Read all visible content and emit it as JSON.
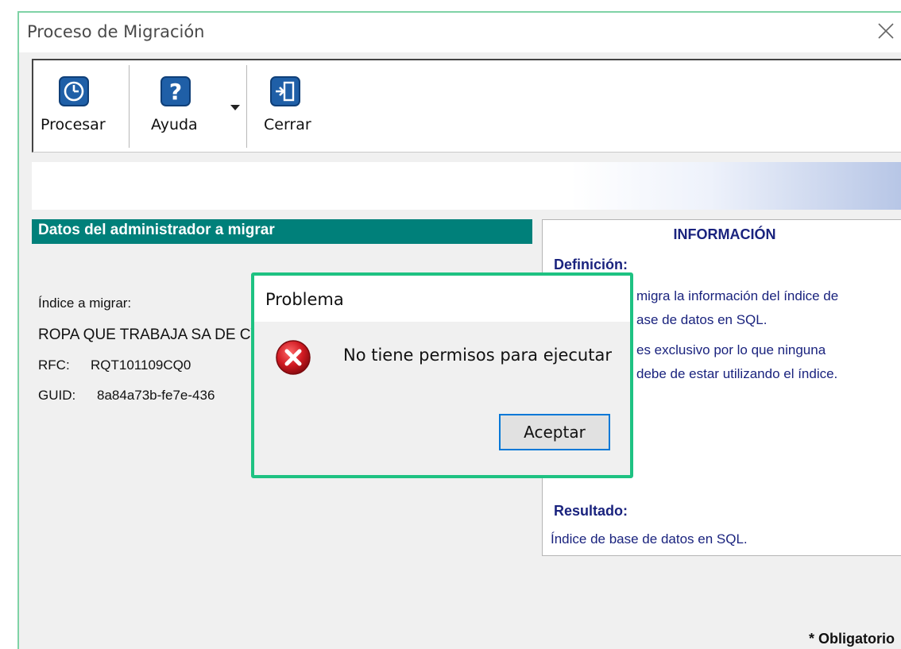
{
  "window": {
    "title": "Proceso de Migración"
  },
  "toolbar": {
    "procesar_label": "Procesar",
    "ayuda_label": "Ayuda",
    "cerrar_label": "Cerrar"
  },
  "section": {
    "header": "Datos del administrador a migrar"
  },
  "admin": {
    "indice_label": "Índice a migrar:",
    "company": "ROPA QUE TRABAJA SA DE CV",
    "rfc_label": "RFC:",
    "rfc_value": "RQT101109CQ0",
    "guid_label": "GUID:",
    "guid_value": "8a84a73b-fe7e-436"
  },
  "info": {
    "title": "INFORMACIÓN",
    "definicion_heading": "Definición:",
    "def_line1": "migra la información del índice de",
    "def_line2": "ase de datos en SQL.",
    "def_line3": "es exclusivo por lo que ninguna",
    "def_line4": "debe de estar utilizando el índice.",
    "resultado_heading": "Resultado:",
    "resultado_text": "Índice de base de datos en SQL."
  },
  "footer": {
    "obligatorio": "* Obligatorio"
  },
  "dialog": {
    "title": "Problema",
    "message": "No tiene permisos para ejecutar",
    "ok_label": "Aceptar"
  },
  "colors": {
    "section_header": "#00807a",
    "info_text": "#1a237e",
    "dialog_highlight": "#1ec282",
    "icon_blue": "#1f5fa7",
    "error_red": "#c8141e"
  },
  "icons": {
    "procesar": "clock-icon",
    "ayuda": "question-icon",
    "cerrar": "exit-door-icon",
    "dialog": "error-icon",
    "close": "close-icon"
  }
}
